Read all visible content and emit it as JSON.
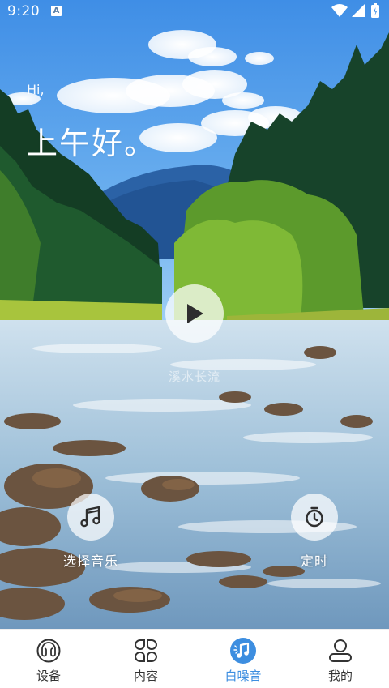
{
  "status_bar": {
    "time": "9:20",
    "notification_icon": "A"
  },
  "greeting": {
    "hi": "Hi,",
    "main": "上午好。"
  },
  "player": {
    "play_icon": "play-icon",
    "track_name": "溪水长流"
  },
  "actions": {
    "select_music": "选择音乐",
    "timer": "定时"
  },
  "bottom_nav": {
    "items": [
      {
        "label": "设备",
        "icon": "device-icon"
      },
      {
        "label": "内容",
        "icon": "grid-icon"
      },
      {
        "label": "白噪音",
        "icon": "white-noise-icon"
      },
      {
        "label": "我的",
        "icon": "profile-icon"
      }
    ],
    "active_index": 2,
    "active_color": "#3d8ee0",
    "inactive_color": "#333333"
  }
}
